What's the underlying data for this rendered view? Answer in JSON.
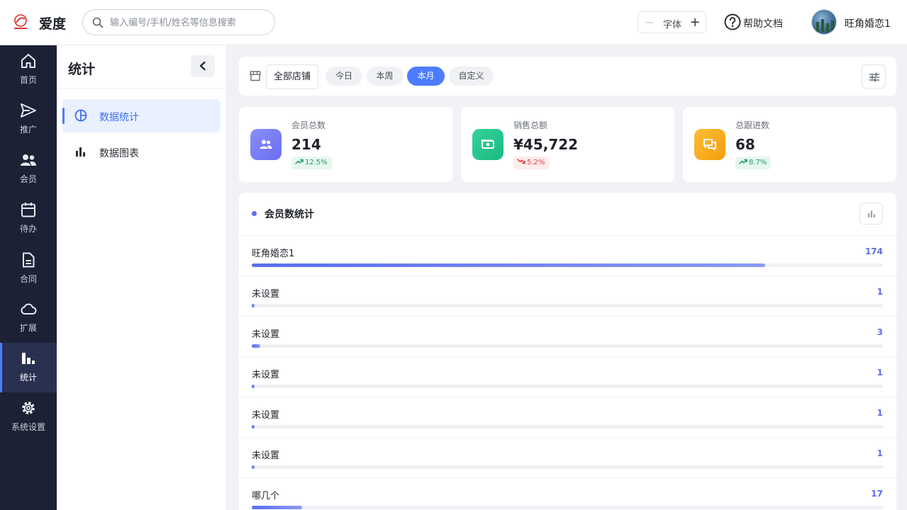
{
  "app": {
    "brand": "爱度"
  },
  "search": {
    "placeholder": "输入编号/手机/姓名等信息搜索"
  },
  "header": {
    "font_label": "字体",
    "font_minus": "−",
    "font_plus": "+",
    "help_label": "帮助文档",
    "user_name": "旺角婚恋1"
  },
  "nav": {
    "items": [
      {
        "label": "首页",
        "icon": "home-icon"
      },
      {
        "label": "推广",
        "icon": "send-icon"
      },
      {
        "label": "会员",
        "icon": "users-icon"
      },
      {
        "label": "待办",
        "icon": "calendar-icon"
      },
      {
        "label": "合同",
        "icon": "document-icon"
      },
      {
        "label": "扩展",
        "icon": "cloud-icon"
      },
      {
        "label": "统计",
        "icon": "bar-chart-icon",
        "active": true
      },
      {
        "label": "系统设置",
        "icon": "gear-icon"
      }
    ]
  },
  "sidebar": {
    "title": "统计",
    "items": [
      {
        "label": "数据统计",
        "icon": "pie-chart-icon",
        "active": true
      },
      {
        "label": "数据图表",
        "icon": "bar-chart-icon"
      }
    ]
  },
  "filters": {
    "store": "全部店铺",
    "ranges": [
      "今日",
      "本周",
      "本月",
      "自定义"
    ],
    "active_range": "本月"
  },
  "stats": [
    {
      "label": "会员总数",
      "value": "214",
      "change": "12.5%",
      "trend": "up",
      "color": "#7b7ef5"
    },
    {
      "label": "销售总额",
      "value": "¥45,722",
      "change": "5.2%",
      "trend": "down",
      "color": "#22c28b"
    },
    {
      "label": "总跟进数",
      "value": "68",
      "change": "8.7%",
      "trend": "up",
      "color": "#f7ad1f"
    }
  ],
  "panel": {
    "title": "会员数统计"
  },
  "chart_data": {
    "type": "bar",
    "categories": [
      "旺角婚恋1",
      "未设置",
      "未设置",
      "未设置",
      "未设置",
      "未设置",
      "哪几个"
    ],
    "values": [
      174,
      1,
      3,
      1,
      1,
      1,
      17
    ],
    "title": "会员数统计",
    "xlabel": "",
    "ylabel": "",
    "ylim": [
      0,
      214
    ]
  },
  "colors": {
    "accent": "#4d7cfe",
    "bar": "#5b6ef0",
    "nav_bg": "#1c2135"
  }
}
